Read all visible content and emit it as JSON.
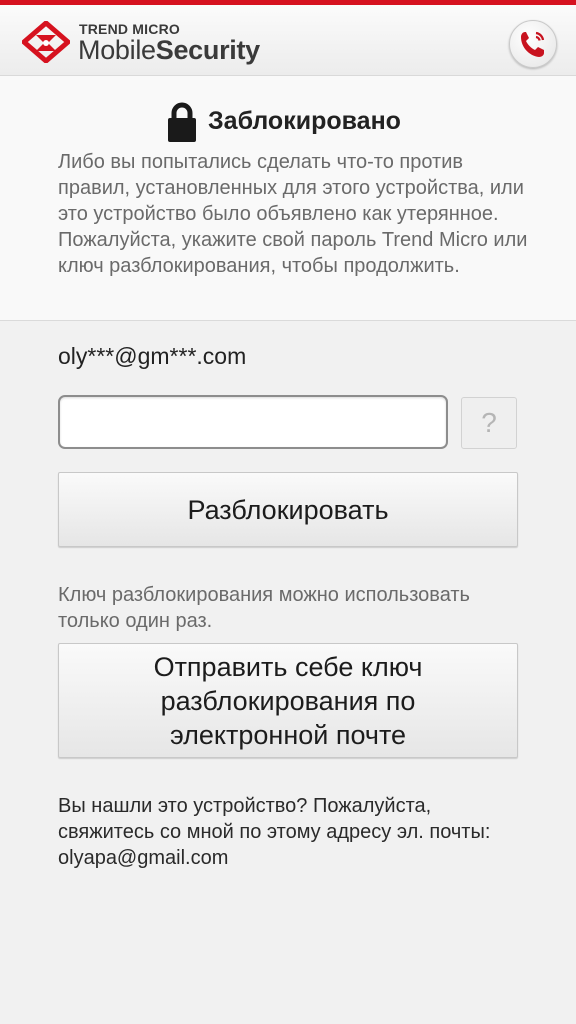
{
  "header": {
    "brand_top": "TREND MICRO",
    "brand_main_light": "Mobile",
    "brand_main_bold": "Security",
    "logo_icon": "trend-micro-logo-icon",
    "call_icon": "phone-call-icon",
    "accent_color": "#d6121f"
  },
  "lock_panel": {
    "icon": "lock-icon",
    "title": "Заблокировано",
    "description": "Либо вы попытались сделать что-то против правил, установленных для этого устройства, или это устройство было объявлено как утерянное. Пожалуйста, укажите свой пароль Trend Micro или ключ разблокирования, чтобы продолжить."
  },
  "account": {
    "masked_email": "oly***@gm***.com"
  },
  "password_field": {
    "value": "",
    "placeholder": ""
  },
  "help_button": {
    "label": "?"
  },
  "unlock_button": {
    "label": "Разблокировать"
  },
  "key_note": "Ключ разблокирования можно использовать только один раз.",
  "send_key_button": {
    "label": "Отправить себе ключ разблокирования по электронной почте"
  },
  "found_note": "Вы нашли это устройство? Пожалуйста, свяжитесь со мной по этому адресу эл. почты: olyapa@gmail.com"
}
